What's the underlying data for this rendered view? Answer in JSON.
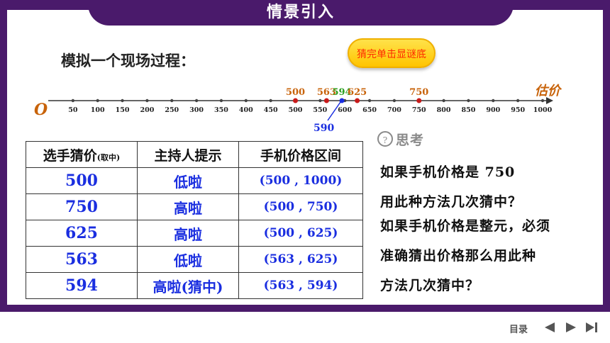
{
  "header": {
    "title": "情景引入"
  },
  "intro": {
    "text": "模拟一个现场过程："
  },
  "reveal_button": {
    "label": "猜完单击显谜底"
  },
  "numberline": {
    "origin_label": "O",
    "axis_label": "估价",
    "ticks": [
      "50",
      "100",
      "150",
      "200",
      "250",
      "300",
      "350",
      "400",
      "450",
      "500",
      "550",
      "600",
      "650",
      "700",
      "750",
      "800",
      "850",
      "900",
      "950",
      "1000"
    ],
    "markers": [
      {
        "value": 500,
        "label": "500",
        "color": "#c8630a"
      },
      {
        "value": 563,
        "label": "563",
        "color": "#c8630a"
      },
      {
        "value": 594,
        "label": "594",
        "color": "#2aa020"
      },
      {
        "value": 625,
        "label": "625",
        "color": "#c8630a"
      },
      {
        "value": 750,
        "label": "750",
        "color": "#c8630a"
      }
    ],
    "pointer_label": "590"
  },
  "table": {
    "headers": {
      "guess": "选手猜价",
      "guess_note": "(取中)",
      "hint": "主持人提示",
      "range": "手机价格区间"
    },
    "rows": [
      {
        "guess": "500",
        "hint": "低啦",
        "range": "(500 , 1000)"
      },
      {
        "guess": "750",
        "hint": "高啦",
        "range": "(500 , 750)"
      },
      {
        "guess": "625",
        "hint": "高啦",
        "range": "(500 , 625)"
      },
      {
        "guess": "563",
        "hint": "低啦",
        "range": "(563 , 625)"
      },
      {
        "guess": "594",
        "hint": "高啦(猜中)",
        "range": "(563 , 594)"
      }
    ]
  },
  "think": {
    "label": "思考",
    "q1_line1": "如果手机价格是 750",
    "q1_line2": "用此种方法几次猜中？",
    "q2_line1": "如果手机价格是整元，必须",
    "q2_line2": "准确猜出价格那么用此种",
    "q2_line3": "方法几次猜中？"
  },
  "footer": {
    "menu_label": "目录"
  },
  "colors": {
    "frame": "#4a1a6b",
    "marker": "#c8630a",
    "value_text": "#1a2ee0",
    "pointer": "#1a2ee0"
  }
}
